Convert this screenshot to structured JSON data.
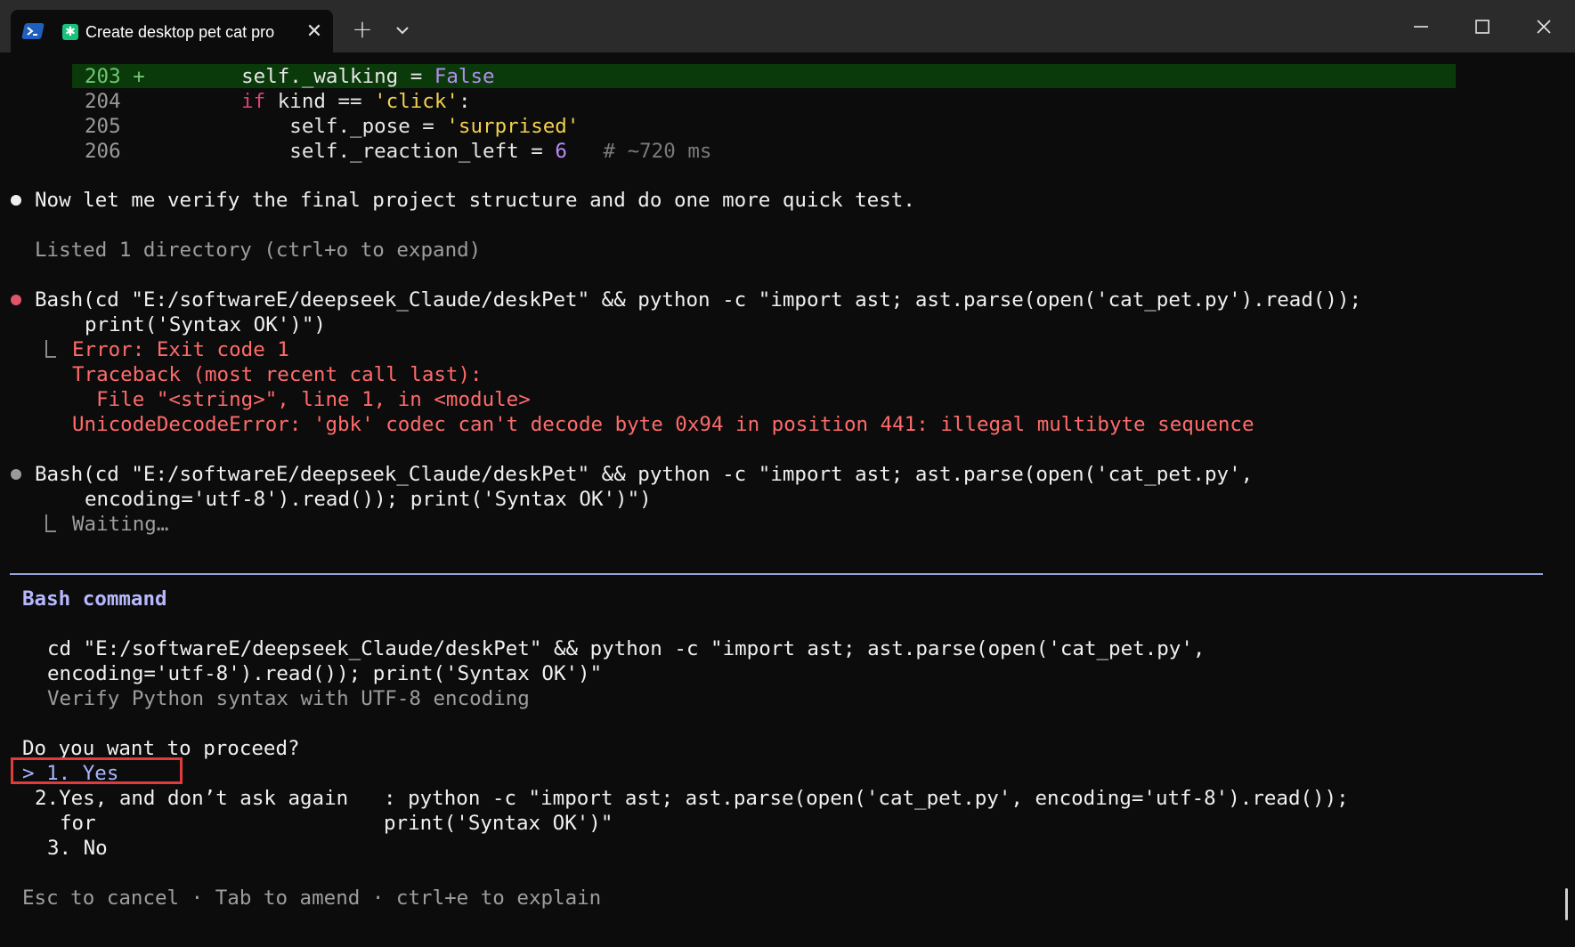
{
  "window": {
    "tab_title": "Create desktop pet cat pro",
    "app_icon": "powershell-icon",
    "tab_icon": "claude-code-icon",
    "new_tab_label": "+",
    "controls": [
      "minimize-icon",
      "maximize-icon",
      "close-icon"
    ]
  },
  "diff": {
    "lines": [
      {
        "num": "203",
        "marker": "+",
        "code": "        self._walking = False"
      },
      {
        "num": "204",
        "code": "        if kind == 'click':"
      },
      {
        "num": "205",
        "code": "            self._pose = 'surprised'"
      },
      {
        "num": "206",
        "code": "            self._reaction_left = 6",
        "comment": "# ~720 ms"
      }
    ]
  },
  "transcript": {
    "message": "Now let me verify the final project structure and do one more quick test.",
    "listed": "Listed 1 directory (ctrl+o to expand)",
    "bash1": {
      "line1": "Bash(cd \"E:/softwareE/deepseek_Claude/deskPet\" && python -c \"import ast; ast.parse(open('cat_pet.py').read());",
      "line2": "print('Syntax OK')\")",
      "error_title": "Error: Exit code 1",
      "error_lines": [
        "Traceback (most recent call last):",
        "  File \"<string>\", line 1, in <module>",
        "UnicodeDecodeError: 'gbk' codec can't decode byte 0x94 in position 441: illegal multibyte sequence"
      ]
    },
    "bash2": {
      "line1": "Bash(cd \"E:/softwareE/deepseek_Claude/deskPet\" && python -c \"import ast; ast.parse(open('cat_pet.py',",
      "line2": "encoding='utf-8').read()); print('Syntax OK')\")",
      "status": "Waiting…"
    }
  },
  "prompt": {
    "title": "Bash command",
    "command_line1": "cd \"E:/softwareE/deepseek_Claude/deskPet\" && python -c \"import ast; ast.parse(open('cat_pet.py',",
    "command_line2": "encoding='utf-8').read()); print('Syntax OK')\"",
    "description": "Verify Python syntax with UTF-8 encoding",
    "question": "Do you want to proceed?",
    "options": {
      "opt1": "> 1. Yes",
      "opt2_label_line1": "2.Yes, and don’t ask again",
      "opt2_label_line2": "for",
      "opt2_detail_line1": ": python -c \"import ast; ast.parse(open('cat_pet.py', encoding='utf-8').read());",
      "opt2_detail_line2": "print('Syntax OK')\"",
      "opt3": "3. No"
    },
    "hint": "Esc to cancel · Tab to amend · ctrl+e to explain"
  },
  "colors": {
    "background": "#0c0c0c",
    "added_line_bg": "#0a3a0a",
    "keyword": "#e0417a",
    "string": "#f2d04f",
    "number": "#b58cf2",
    "error": "#ff6b6b",
    "prompt_title": "#b8b8ff",
    "annotation_box": "#e23b3b"
  }
}
